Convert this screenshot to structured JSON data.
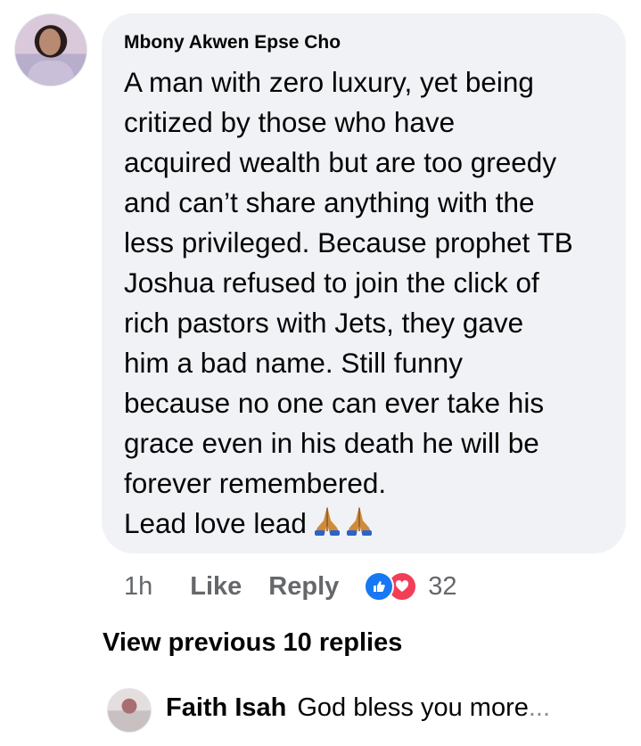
{
  "comment": {
    "author": "Mbony Akwen Epse Cho",
    "lines": [
      "A man with zero luxury, yet being",
      "critized  by those who have",
      "acquired wealth but are too greedy",
      "and can’t share anything with the",
      "less privileged. Because prophet TB",
      "Joshua refused to join the click of",
      "rich pastors with Jets, they gave",
      "him a bad name. Still funny",
      "because no one can ever take his",
      "grace even in his death he will be",
      "forever remembered.",
      "Lead love lead"
    ],
    "time": "1h",
    "like_label": "Like",
    "reply_label": "Reply",
    "reaction_count": "32",
    "reaction_icons": [
      "like-icon",
      "love-icon"
    ]
  },
  "replies": {
    "view_previous": "View previous 10 replies",
    "latest": {
      "author": "Faith Isah",
      "text": "God bless you more",
      "ellipsis": "..."
    }
  },
  "colors": {
    "bubble": "#f0f2f5",
    "secondary_text": "#65676b",
    "like_blue": "#1877f2",
    "love_red": "#f33e58"
  }
}
